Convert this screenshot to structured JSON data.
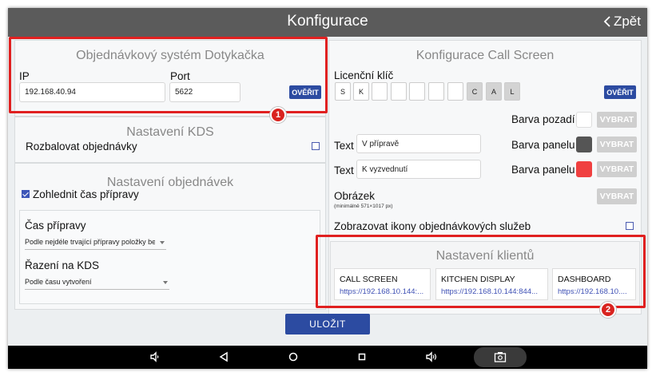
{
  "header": {
    "title": "Konfigurace",
    "back_label": "Zpět"
  },
  "order_system": {
    "title": "Objednávkový systém Dotykačka",
    "ip_label": "IP",
    "ip_value": "192.168.40.94",
    "port_label": "Port",
    "port_value": "5622",
    "verify_label": "OVĚŘIT"
  },
  "kds": {
    "title": "Nastavení KDS",
    "expand_label": "Rozbalovat objednávky",
    "expand_checked": false
  },
  "orders": {
    "title": "Nastavení objednávek",
    "consider_prep_label": "Zohlednit čas přípravy",
    "consider_prep_checked": true,
    "prep_time_label": "Čas přípravy",
    "prep_time_value": "Podle nejdéle trvající přípravy položky ber",
    "sort_label": "Řazení na KDS",
    "sort_value": "Podle času vytvoření"
  },
  "call_screen": {
    "title": "Konfigurace Call Screen",
    "license_label": "Licenční klíč",
    "license_keys": [
      "S",
      "K",
      "",
      "",
      "",
      "",
      "",
      "C",
      "A",
      "L"
    ],
    "verify_label": "OVĚŘIT",
    "bg_color_label": "Barva pozadí",
    "bg_color": "#ffffff",
    "text1_label": "Text",
    "text1_value": "V přípravě",
    "panel1_label": "Barva panelu",
    "panel1_color": "#555555",
    "text2_label": "Text",
    "text2_value": "K vyzvednutí",
    "panel2_label": "Barva panelu",
    "panel2_color": "#f04040",
    "choose_label": "VYBRAT",
    "image_label": "Obrázek",
    "image_hint": "(minimálně 571×1017 px)",
    "show_icons_label": "Zobrazovat ikony objednávkových služeb",
    "show_icons_checked": false
  },
  "clients": {
    "title": "Nastavení klientů",
    "items": [
      {
        "name": "CALL SCREEN",
        "url": "https://192.168.10.144:..."
      },
      {
        "name": "KITCHEN DISPLAY",
        "url": "https://192.168.10.144:844..."
      },
      {
        "name": "DASHBOARD",
        "url": "https://192.168.10...."
      }
    ]
  },
  "save_label": "ULOŽIT",
  "annotations": {
    "badge1": "1",
    "badge2": "2"
  },
  "colors": {
    "accent": "#2c4ba1",
    "topbar": "#5b5b5b",
    "highlight": "#e02020"
  }
}
